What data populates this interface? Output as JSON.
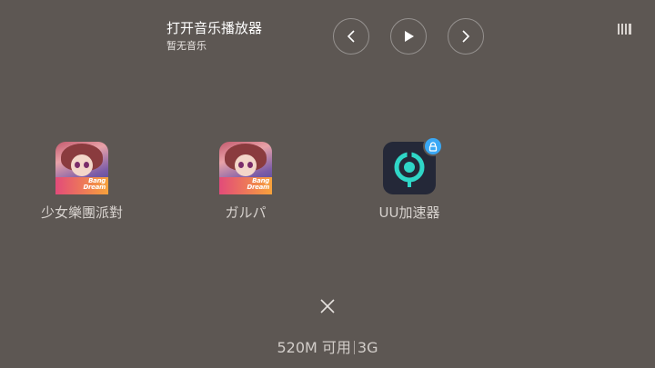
{
  "music": {
    "title": "打开音乐播放器",
    "subtitle": "暂无音乐",
    "controls": [
      "previous-icon",
      "play-icon",
      "next-icon"
    ]
  },
  "header": {
    "menu_icon": "list-icon"
  },
  "apps": [
    {
      "label": "少女樂團派對",
      "icon": "bang-dream-icon",
      "locked": false
    },
    {
      "label": "ガルパ",
      "icon": "bang-dream-icon",
      "locked": false
    },
    {
      "label": "UU加速器",
      "icon": "uu-accelerator-icon",
      "locked": true
    }
  ],
  "footer": {
    "close_icon": "close-icon",
    "available": "520M 可用",
    "total": "3G"
  },
  "colors": {
    "background": "#5d5753",
    "lock_badge": "#3aa8f5",
    "uu_accent": "#2fd6c7"
  }
}
